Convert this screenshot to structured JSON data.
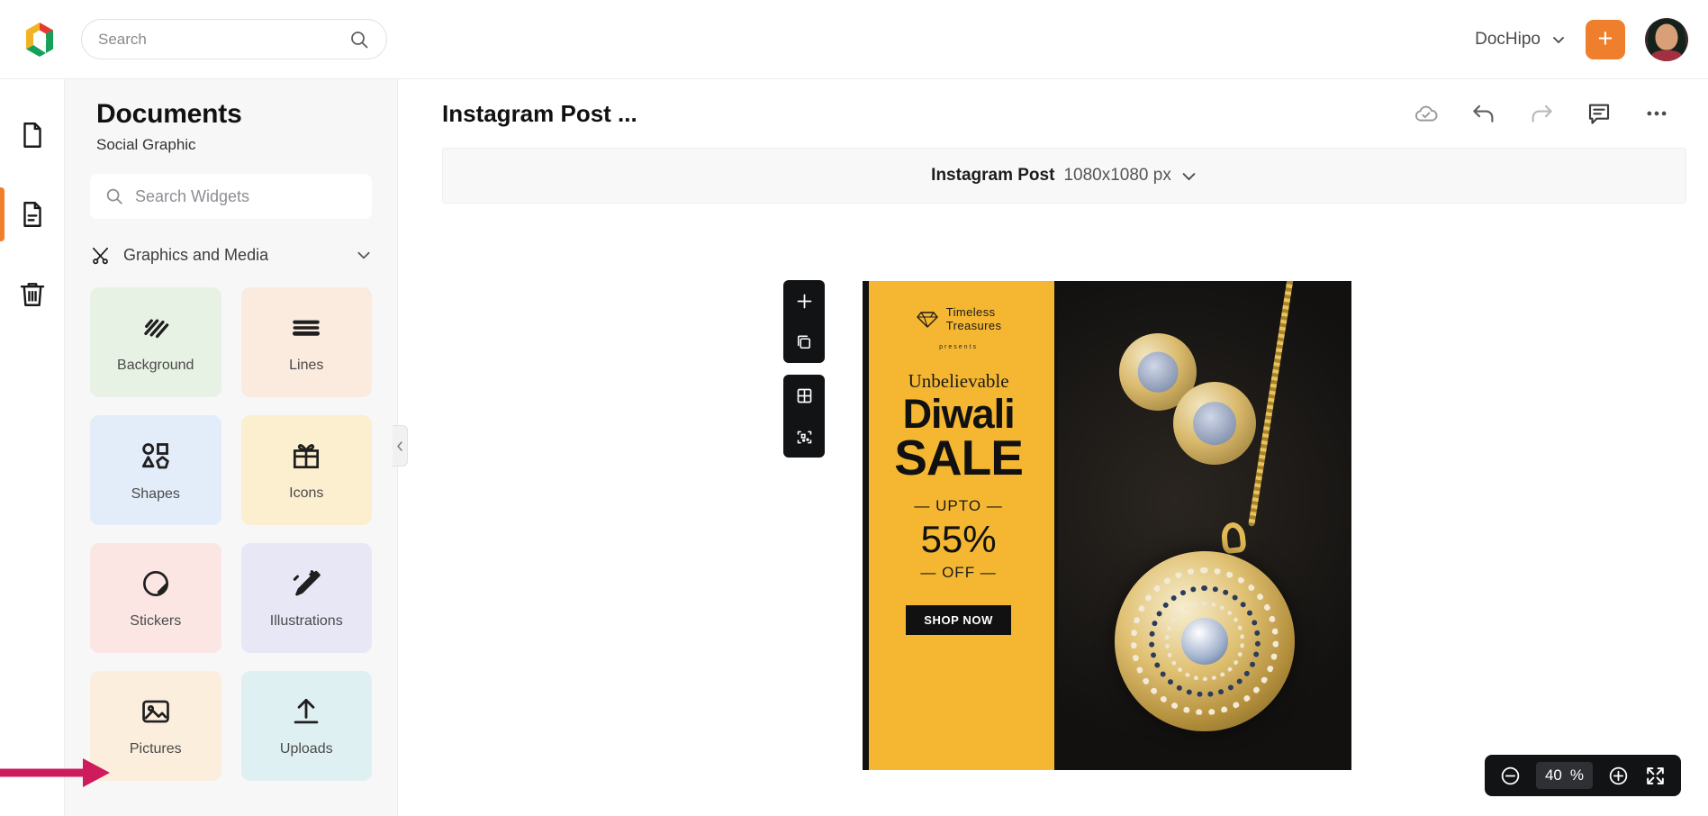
{
  "topbar": {
    "logo_icon": "dochipo-logo-icon",
    "search": {
      "placeholder": "Search",
      "value": "",
      "icon": "search-icon"
    },
    "account_name": "DocHipo",
    "account_chevron_icon": "chevron-down-icon",
    "create_button_label": "+",
    "avatar_name": "user-avatar"
  },
  "rail": {
    "items": [
      {
        "icon": "page-blank-icon",
        "name": "pages",
        "active": false
      },
      {
        "icon": "page-lines-icon",
        "name": "documents",
        "active": true
      },
      {
        "icon": "trash-icon",
        "name": "trash",
        "active": false
      }
    ]
  },
  "panel": {
    "title": "Documents",
    "subtitle": "Social Graphic",
    "search": {
      "placeholder": "Search Widgets",
      "value": "",
      "icon": "search-icon"
    },
    "section": {
      "label": "Graphics and Media",
      "icon": "graphics-media-icon",
      "chevron": "chevron-down-icon"
    },
    "tiles": [
      {
        "label": "Background",
        "icon": "background-stripes-icon",
        "bg": "#e8f2e4"
      },
      {
        "label": "Lines",
        "icon": "lines-icon",
        "bg": "#fbeade"
      },
      {
        "label": "Shapes",
        "icon": "shapes-icon",
        "bg": "#e3edf9"
      },
      {
        "label": "Icons",
        "icon": "gift-icon",
        "bg": "#fcefcf"
      },
      {
        "label": "Stickers",
        "icon": "sticker-icon",
        "bg": "#fbe6e3"
      },
      {
        "label": "Illustrations",
        "icon": "illustration-pen-icon",
        "bg": "#e8e7f6"
      },
      {
        "label": "Pictures",
        "icon": "picture-icon",
        "bg": "#fbeedd"
      },
      {
        "label": "Uploads",
        "icon": "upload-icon",
        "bg": "#dff0f2"
      }
    ],
    "collapse_icon": "chevron-left-icon"
  },
  "editor": {
    "doc_title": "Instagram Post ...",
    "tools": [
      {
        "name": "cloud-saved-icon",
        "label": "cloud-saved"
      },
      {
        "name": "undo-icon",
        "label": "undo"
      },
      {
        "name": "redo-icon",
        "label": "redo"
      },
      {
        "name": "comment-icon",
        "label": "comments"
      },
      {
        "name": "more-options-icon",
        "label": "more"
      }
    ],
    "size_bar": {
      "name": "Instagram Post",
      "dimensions": "1080x1080 px",
      "chevron_icon": "chevron-down-icon"
    },
    "page_tools": [
      {
        "icon": "add-page-icon",
        "name": "add-page"
      },
      {
        "icon": "duplicate-page-icon",
        "name": "duplicate-page"
      },
      {
        "icon": "grid-icon",
        "name": "grid"
      },
      {
        "icon": "select-area-icon",
        "name": "select-area"
      }
    ],
    "zoom": {
      "minus_icon": "zoom-out-icon",
      "value": "40",
      "unit": "%",
      "plus_icon": "zoom-in-icon",
      "fullscreen_icon": "fullscreen-icon"
    }
  },
  "artboard": {
    "brand_name_line1": "Timeless",
    "brand_name_line2": "Treasures",
    "gem_icon": "diamond-icon",
    "presents": "presents",
    "headline_small": "Unbelievable",
    "headline_1": "Diwali",
    "headline_2": "SALE",
    "upto": "— UPTO —",
    "percent": "55%",
    "off": "— OFF —",
    "cta": "SHOP NOW",
    "colors": {
      "accent": "#f5b731",
      "dark": "#111111",
      "gold": "#d9b96b"
    }
  },
  "annotation": {
    "arrow_color": "#cf1a5b",
    "name": "pointer-arrow"
  }
}
